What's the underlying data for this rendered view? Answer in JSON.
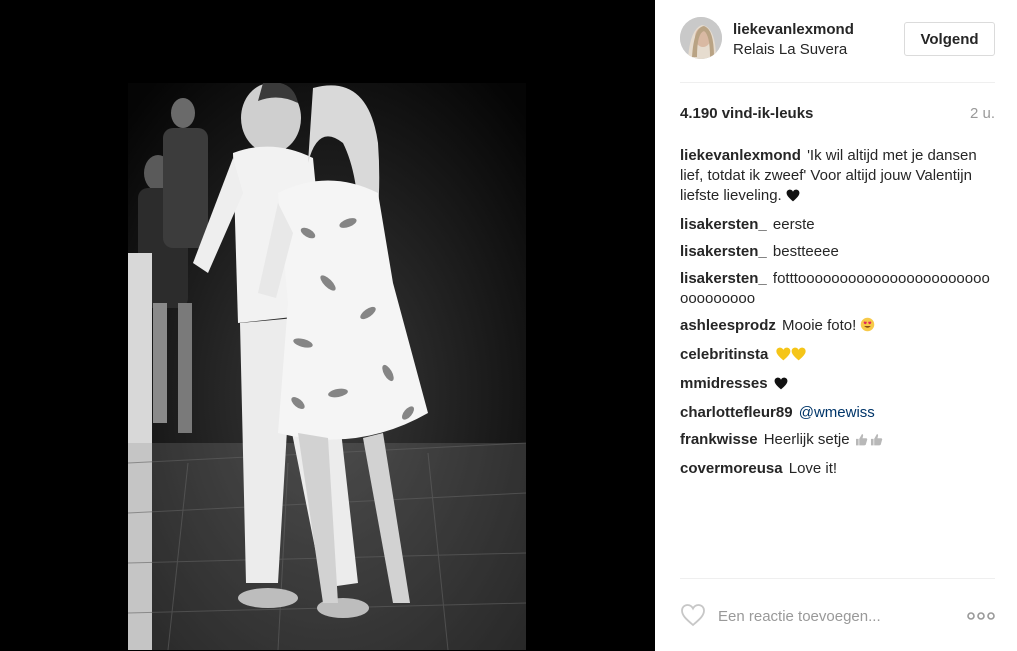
{
  "post": {
    "image_alt": "Zwart-witfoto van een dansend stel"
  },
  "header": {
    "username": "liekevanlexmond",
    "location": "Relais La Suvera",
    "follow_label": "Volgend"
  },
  "stats": {
    "likes": "4.190 vind-ik-leuks",
    "time": "2 u."
  },
  "comments": [
    {
      "author": "liekevanlexmond",
      "text": "'Ik wil altijd met je dansen lief, totdat ik zweef' Voor altijd jouw Valentijn liefste lieveling.",
      "emoji": "black-heart-icon"
    },
    {
      "author": "lisakersten_",
      "text": "eerste"
    },
    {
      "author": "lisakersten_",
      "text": "bestteeee"
    },
    {
      "author": "lisakersten_",
      "text": "fotttoooooooooooooooooooooooooooooooo"
    },
    {
      "author": "ashleesprodz",
      "text": "Mooie foto!",
      "emoji": "heart-eyes-icon"
    },
    {
      "author": "celebritinsta",
      "text": "",
      "emoji": "yellow-hearts-icon"
    },
    {
      "author": "mmidresses",
      "text": "",
      "emoji": "black-heart-icon"
    },
    {
      "author": "charlottefleur89",
      "mention": "@wmewiss"
    },
    {
      "author": "frankwisse",
      "text": "Heerlijk setje",
      "emoji": "thumbs-up-icon"
    },
    {
      "author": "covermoreusa",
      "text": "Love it!"
    }
  ],
  "footer": {
    "comment_placeholder": "Een reactie toevoegen...",
    "like_icon": "heart-outline-icon",
    "more_icon": "more-options-icon"
  },
  "colors": {
    "text": "#262626",
    "muted": "#999999",
    "mention": "#003569",
    "divider": "#efefef",
    "media_background": "#000000"
  }
}
